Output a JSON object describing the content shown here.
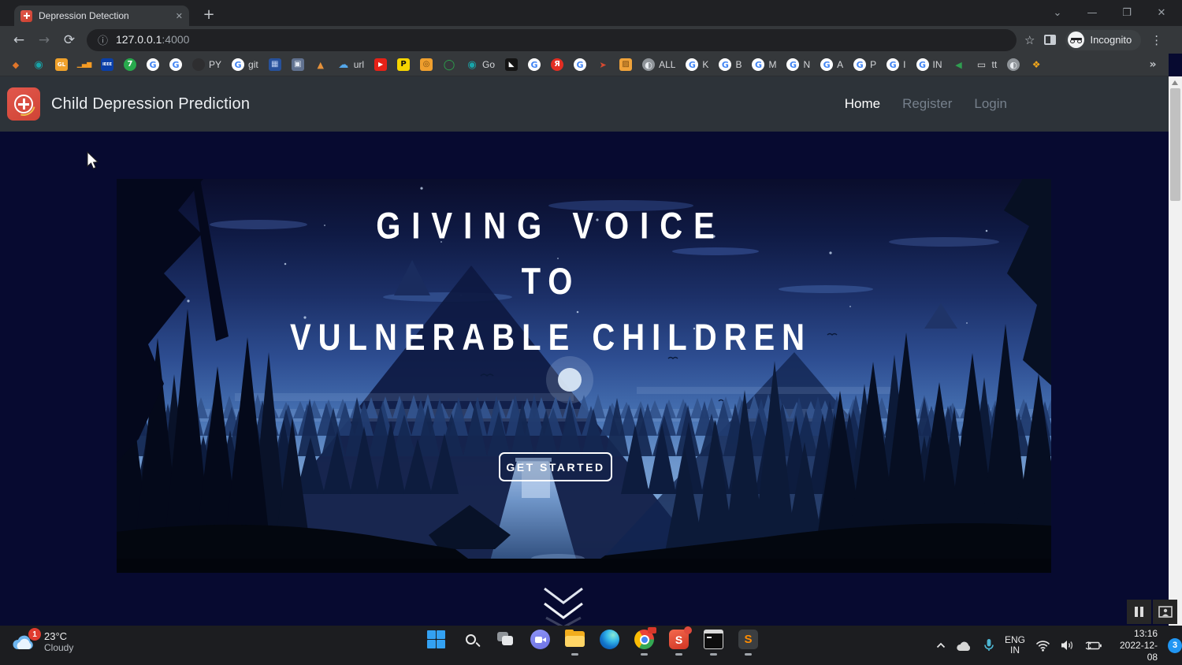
{
  "colors": {
    "page_background": "#070a30",
    "header_background": "#2d3339",
    "taskbar_background": "#1c1d20",
    "logo_accent": "#e2574c"
  },
  "browser": {
    "tab": {
      "title": "Depression Detection",
      "close_icon": "✕"
    },
    "new_tab_icon": "+",
    "window_controls": {
      "menu": "⌄",
      "minimize": "—",
      "maximize": "❐",
      "close": "✕"
    },
    "toolbar": {
      "back_icon": "←",
      "forward_icon": "→",
      "reload_icon": "⟳",
      "info_icon": "ⓘ",
      "star_icon": "☆",
      "menu_icon": "⋮"
    },
    "url": {
      "host": "127.0.0.1",
      "port": ":4000"
    },
    "incognito_label": "Incognito",
    "bookmarks": [
      {
        "name": "bookmark-arrow",
        "shape": "none",
        "fg": "#e0762a",
        "glyph": "◆",
        "label": "",
        "fs": 11
      },
      {
        "name": "bookmark-teal-circle",
        "shape": "none",
        "fg": "#18a5a9",
        "glyph": "◉",
        "label": "",
        "fs": 13
      },
      {
        "name": "bookmark-gl",
        "shape": "square",
        "bg": "#f0a12b",
        "fg": "#ffffff",
        "glyph": "GL",
        "label": "",
        "fs": 7
      },
      {
        "name": "bookmark-analytics",
        "shape": "none",
        "fg": "#f59b23",
        "glyph": "▁▄▆",
        "label": "",
        "fs": 8
      },
      {
        "name": "bookmark-ieee",
        "shape": "square",
        "bg": "#0a3fa8",
        "fg": "#ffffff",
        "glyph": "IEEE",
        "label": "",
        "fs": 5
      },
      {
        "name": "bookmark-seven",
        "shape": "circle",
        "bg": "#28a94d",
        "fg": "#ffffff",
        "glyph": "7",
        "label": "",
        "fs": 10
      },
      {
        "name": "bookmark-google",
        "shape": "circle",
        "bg": "#ffffff",
        "fg": "#4285f4",
        "glyph": "G",
        "label": "",
        "fs": 11
      },
      {
        "name": "bookmark-google",
        "shape": "circle",
        "bg": "#ffffff",
        "fg": "#4285f4",
        "glyph": "G",
        "label": "",
        "fs": 11
      },
      {
        "name": "bookmark-github-py",
        "shape": "circle",
        "bg": "#2e2e30",
        "fg": "#ffffff",
        "glyph": "",
        "label": "PY",
        "fs": 10
      },
      {
        "name": "bookmark-google-git",
        "shape": "circle",
        "bg": "#ffffff",
        "fg": "#4285f4",
        "glyph": "G",
        "label": "git",
        "fs": 11
      },
      {
        "name": "bookmark-film",
        "shape": "square",
        "bg": "#27519b",
        "fg": "#b9cdf0",
        "glyph": "▦",
        "label": "",
        "fs": 10
      },
      {
        "name": "bookmark-panel",
        "shape": "square",
        "bg": "#60718f",
        "fg": "#e2e8f2",
        "glyph": "▣",
        "label": "",
        "fs": 10
      },
      {
        "name": "bookmark-peaks",
        "shape": "none",
        "fg": "#e5913a",
        "glyph": "▲",
        "label": "",
        "fs": 11
      },
      {
        "name": "bookmark-url",
        "shape": "none",
        "fg": "#54a7ea",
        "glyph": "☁",
        "label": "url",
        "fs": 13
      },
      {
        "name": "bookmark-youtube",
        "shape": "square",
        "bg": "#e62117",
        "fg": "#ffffff",
        "glyph": "▶",
        "label": "",
        "fs": 8
      },
      {
        "name": "bookmark-p",
        "shape": "square",
        "bg": "#f6d500",
        "fg": "#111111",
        "glyph": "P",
        "label": "",
        "fs": 10
      },
      {
        "name": "bookmark-camera",
        "shape": "square",
        "bg": "#ef9f2e",
        "fg": "#7a4a10",
        "glyph": "◎",
        "label": "",
        "fs": 10
      },
      {
        "name": "bookmark-ring",
        "shape": "none",
        "fg": "#2ba84c",
        "glyph": "◯",
        "label": "",
        "fs": 13
      },
      {
        "name": "bookmark-godaddy-go",
        "shape": "none",
        "fg": "#18a5a9",
        "glyph": "◉",
        "label": "Go",
        "fs": 13
      },
      {
        "name": "bookmark-seagull",
        "shape": "square",
        "bg": "#141414",
        "fg": "#ffffff",
        "glyph": "◣",
        "label": "",
        "fs": 9
      },
      {
        "name": "bookmark-google",
        "shape": "circle",
        "bg": "#ffffff",
        "fg": "#4285f4",
        "glyph": "G",
        "label": "",
        "fs": 11
      },
      {
        "name": "bookmark-yandex",
        "shape": "circle",
        "bg": "#e22e23",
        "fg": "#ffffff",
        "glyph": "Я",
        "label": "",
        "fs": 10
      },
      {
        "name": "bookmark-google",
        "shape": "circle",
        "bg": "#ffffff",
        "fg": "#4285f4",
        "glyph": "G",
        "label": "",
        "fs": 11
      },
      {
        "name": "bookmark-bird",
        "shape": "none",
        "fg": "#d84a30",
        "glyph": "➤",
        "label": "",
        "fs": 11
      },
      {
        "name": "bookmark-box",
        "shape": "square",
        "bg": "#efa23a",
        "fg": "#7a4a10",
        "glyph": "▨",
        "label": "",
        "fs": 10
      },
      {
        "name": "bookmark-globe-all",
        "shape": "circle",
        "bg": "#8f9499",
        "fg": "#e8ecf0",
        "glyph": "◐",
        "label": "ALL",
        "fs": 11
      },
      {
        "name": "bookmark-google-k",
        "shape": "circle",
        "bg": "#ffffff",
        "fg": "#4285f4",
        "glyph": "G",
        "label": "K",
        "fs": 11
      },
      {
        "name": "bookmark-google-b",
        "shape": "circle",
        "bg": "#ffffff",
        "fg": "#4285f4",
        "glyph": "G",
        "label": "B",
        "fs": 11
      },
      {
        "name": "bookmark-google-m",
        "shape": "circle",
        "bg": "#ffffff",
        "fg": "#4285f4",
        "glyph": "G",
        "label": "M",
        "fs": 11
      },
      {
        "name": "bookmark-google-n",
        "shape": "circle",
        "bg": "#ffffff",
        "fg": "#4285f4",
        "glyph": "G",
        "label": "N",
        "fs": 11
      },
      {
        "name": "bookmark-google-a",
        "shape": "circle",
        "bg": "#ffffff",
        "fg": "#4285f4",
        "glyph": "G",
        "label": "A",
        "fs": 11
      },
      {
        "name": "bookmark-google-p",
        "shape": "circle",
        "bg": "#ffffff",
        "fg": "#4285f4",
        "glyph": "G",
        "label": "P",
        "fs": 11
      },
      {
        "name": "bookmark-google-i",
        "shape": "circle",
        "bg": "#ffffff",
        "fg": "#4285f4",
        "glyph": "G",
        "label": "I",
        "fs": 11
      },
      {
        "name": "bookmark-google-in",
        "shape": "circle",
        "bg": "#ffffff",
        "fg": "#4285f4",
        "glyph": "G",
        "label": "IN",
        "fs": 11
      },
      {
        "name": "bookmark-media",
        "shape": "none",
        "fg": "#2f9e50",
        "glyph": "◀",
        "label": "",
        "fs": 11
      },
      {
        "name": "bookmark-monitor-tt",
        "shape": "none",
        "fg": "#d8d8d8",
        "glyph": "▭",
        "label": "tt",
        "fs": 12
      },
      {
        "name": "bookmark-globe",
        "shape": "circle",
        "bg": "#8f9499",
        "fg": "#e8ecf0",
        "glyph": "◐",
        "label": "",
        "fs": 11
      },
      {
        "name": "bookmark-photos",
        "shape": "none",
        "fg": "#f2a71b",
        "glyph": "❖",
        "label": "",
        "fs": 12
      },
      {
        "name": "bookmarks-overflow-chevron",
        "shape": "none",
        "fg": "#c0c4c8",
        "glyph": "»",
        "label": "",
        "fs": 14
      }
    ]
  },
  "page": {
    "header": {
      "title": "Child Depression Prediction",
      "nav": [
        {
          "label": "Home",
          "active": true
        },
        {
          "label": "Register",
          "active": false
        },
        {
          "label": "Login",
          "active": false
        }
      ]
    },
    "hero": {
      "line1": "GIVING VOICE",
      "line2": "TO",
      "line3": "VULNERABLE CHILDREN",
      "cta": "GET STARTED"
    }
  },
  "taskbar": {
    "weather": {
      "badge": "1",
      "temperature": "23°C",
      "condition": "Cloudy"
    },
    "apps": [
      "windows-start",
      "search",
      "task-view",
      "chat",
      "file-explorer",
      "edge",
      "chrome",
      "screen-recorder",
      "terminal",
      "sublime-text"
    ],
    "recorder_letter": "S",
    "sublime_letter": "S",
    "tray": {
      "language": "ENG",
      "region": "IN",
      "time": "13:16",
      "date": "2022-12-08",
      "notification_count": "3"
    }
  }
}
